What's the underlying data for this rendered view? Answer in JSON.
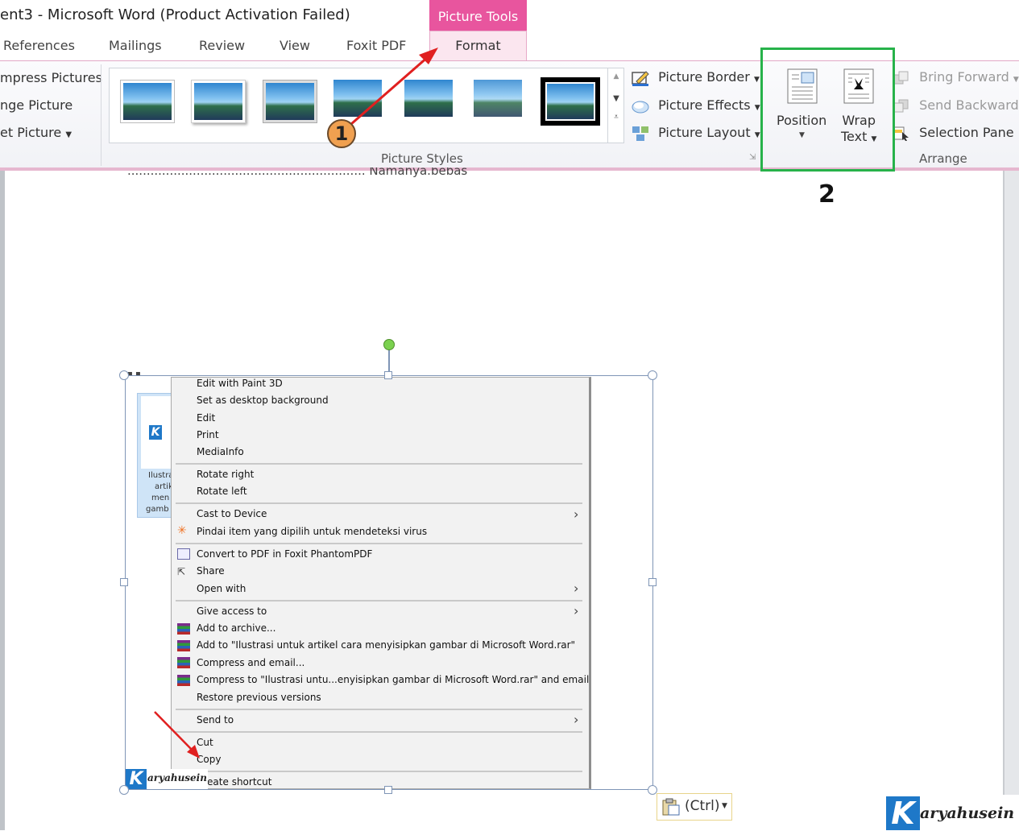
{
  "window": {
    "title": "ent3  -  Microsoft Word (Product Activation Failed)",
    "context_tab_group": "Picture Tools"
  },
  "tabs": [
    "References",
    "Mailings",
    "Review",
    "View",
    "Foxit PDF",
    "Format"
  ],
  "ribbon": {
    "adjust": {
      "items": [
        "mpress Pictures",
        "nge Picture",
        "et Picture"
      ]
    },
    "picture_styles": {
      "label": "Picture Styles",
      "commands": [
        "Picture Border",
        "Picture Effects",
        "Picture Layout"
      ]
    },
    "arrange": {
      "label": "Arrange",
      "position_label": "Position",
      "wrap_label_1": "Wrap",
      "wrap_label_2": "Text",
      "commands": [
        "Bring Forward",
        "Send Backward",
        "Selection Pane"
      ]
    }
  },
  "document": {
    "partial_text": "..............................................................  Namanya.bebas"
  },
  "context_menu": {
    "items": [
      "Edit with Paint 3D",
      "Set as desktop background",
      "Edit",
      "Print",
      "MediaInfo",
      "Rotate right",
      "Rotate left",
      "Cast to Device",
      "Pindai item yang dipilih untuk mendeteksi virus",
      "Convert to PDF in Foxit PhantomPDF",
      "Share",
      "Open with",
      "Give access to",
      "Add to archive...",
      "Add to \"Ilustrasi untuk artikel cara menyisipkan gambar di Microsoft Word.rar\"",
      "Compress and email...",
      "Compress to \"Ilustrasi untu...enyisipkan gambar di Microsoft Word.rar\" and email",
      "Restore previous versions",
      "Send to",
      "Cut",
      "Copy",
      "Create shortcut"
    ]
  },
  "file_thumb": {
    "lines": [
      "Ilustra",
      "artik",
      "men",
      "gamb"
    ]
  },
  "paste_options": {
    "label": "(Ctrl)"
  },
  "watermark": {
    "k": "K",
    "text": "aryahusein",
    "small_text": "aryahusein"
  },
  "annotations": {
    "one": "1",
    "two": "2"
  },
  "colors": {
    "context_tab": "#e8559e",
    "highlight_box": "#27b24a",
    "arrow": "#e02020",
    "annotation_badge": "#f0a050"
  }
}
